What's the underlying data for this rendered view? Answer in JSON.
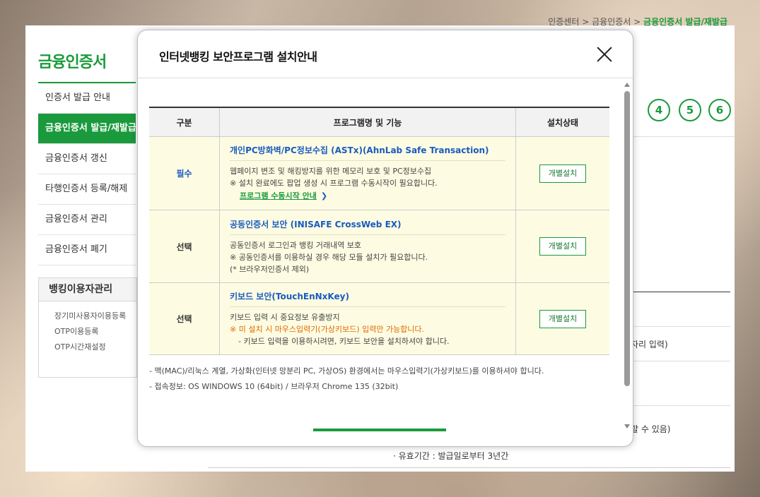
{
  "page": {
    "breadcrumb": [
      "인증센터",
      "금융인증서",
      "금융인증서 발급/재발급"
    ],
    "sidebar": {
      "title": "금융인증서",
      "items": [
        {
          "label": "인증서 발급 안내"
        },
        {
          "label": "금융인증서 발급/재발급"
        },
        {
          "label": "금융인증서 갱신"
        },
        {
          "label": "타행인증서 등록/해제"
        },
        {
          "label": "금융인증서 관리"
        },
        {
          "label": "금융인증서 폐기"
        }
      ],
      "banking": {
        "title": "뱅킹이용자관리",
        "links": [
          "장기미사용자이용등록",
          "OTP이용등록",
          "OTP시간재설정"
        ]
      }
    },
    "steps": [
      "4",
      "5",
      "6"
    ],
    "bg_fragments": {
      "frag1": "자리 입력)",
      "frag2": "할 수 있음)",
      "frag3": "· 유효기간 : 발급일로부터 3년간"
    }
  },
  "modal": {
    "title": "인터넷뱅킹 보안프로그램 설치안내",
    "table": {
      "headers": [
        "구분",
        "프로그램명 및 기능",
        "설치상태"
      ],
      "rows": [
        {
          "type": "필수",
          "name": "개인PC방화벽/PC정보수집 (ASTx)(AhnLab Safe Transaction)",
          "desc": [
            "웹페이지 변조 및 해킹방지를 위한 메모리 보호 및 PC정보수집",
            "※ 설치 완료에도 팝업 생성 시 프로그램 수동시작이 필요합니다."
          ],
          "link": "프로그램 수동시작 안내",
          "button": "개별설치"
        },
        {
          "type": "선택",
          "name": "공동인증서 보안 (INISAFE CrossWeb EX)",
          "desc": [
            "공동인증서 로그인과 뱅킹 거래내역 보호",
            "※ 공동인증서를 이용하실 경우 해당 모듈 설치가 필요합니다.",
            "(* 브라우저인증서 제외)"
          ],
          "button": "개별설치"
        },
        {
          "type": "선택",
          "name": "키보드 보안(TouchEnNxKey)",
          "desc": [
            "키보드 입력 시 중요정보 유출방지"
          ],
          "warn": "※ 미 설치 시 마우스입력기(가상키보드) 입력만 가능합니다.",
          "desc2": "- 키보드 입력을 이용하시려면, 키보드 보안을 설치하셔야 합니다.",
          "button": "개별설치"
        }
      ]
    },
    "notes": [
      "- 맥(MAC)/리눅스 계열, 가상화(인터넷 망분리 PC, 가상OS) 환경에서는 마우스입력기(가상키보드)를 이용하셔야 합니다.",
      "- 접속정보: OS WINDOWS 10 (64bit) / 브라우저 Chrome 135 (32bit)"
    ]
  }
}
